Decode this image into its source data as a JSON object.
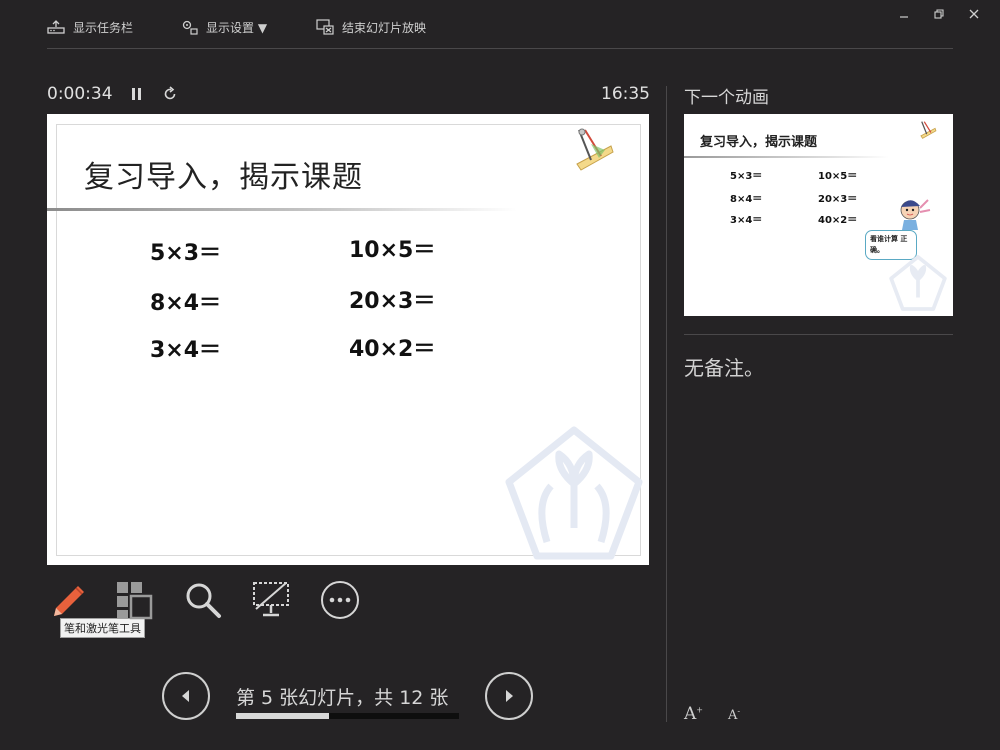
{
  "toolbar": {
    "show_taskbar": "显示任务栏",
    "display_settings": "显示设置 ▼",
    "end_show": "结束幻灯片放映"
  },
  "timer": {
    "elapsed": "0:00:34",
    "clock": "16:35"
  },
  "current_slide": {
    "title": "复习导入，揭示课题",
    "equations": [
      "5×3＝",
      "10×5＝",
      "8×4＝",
      "20×3＝",
      "3×4＝",
      "40×2＝"
    ]
  },
  "next": {
    "label": "下一个动画",
    "title": "复习导入，揭示课题",
    "equations": [
      "5×3＝",
      "10×5＝",
      "8×4＝",
      "20×3＝",
      "3×4＝",
      "40×2＝"
    ],
    "bubble": "看谁计算 正确。"
  },
  "notes": {
    "text": "无备注。"
  },
  "tools": {
    "pen_tooltip": "笔和激光笔工具"
  },
  "navigation": {
    "counter": "第 5 张幻灯片，共 12 张",
    "current": 5,
    "total": 12
  },
  "colors": {
    "background": "#252325",
    "pen_accent": "#e8613c",
    "bubble_border": "#5aa9c4"
  }
}
